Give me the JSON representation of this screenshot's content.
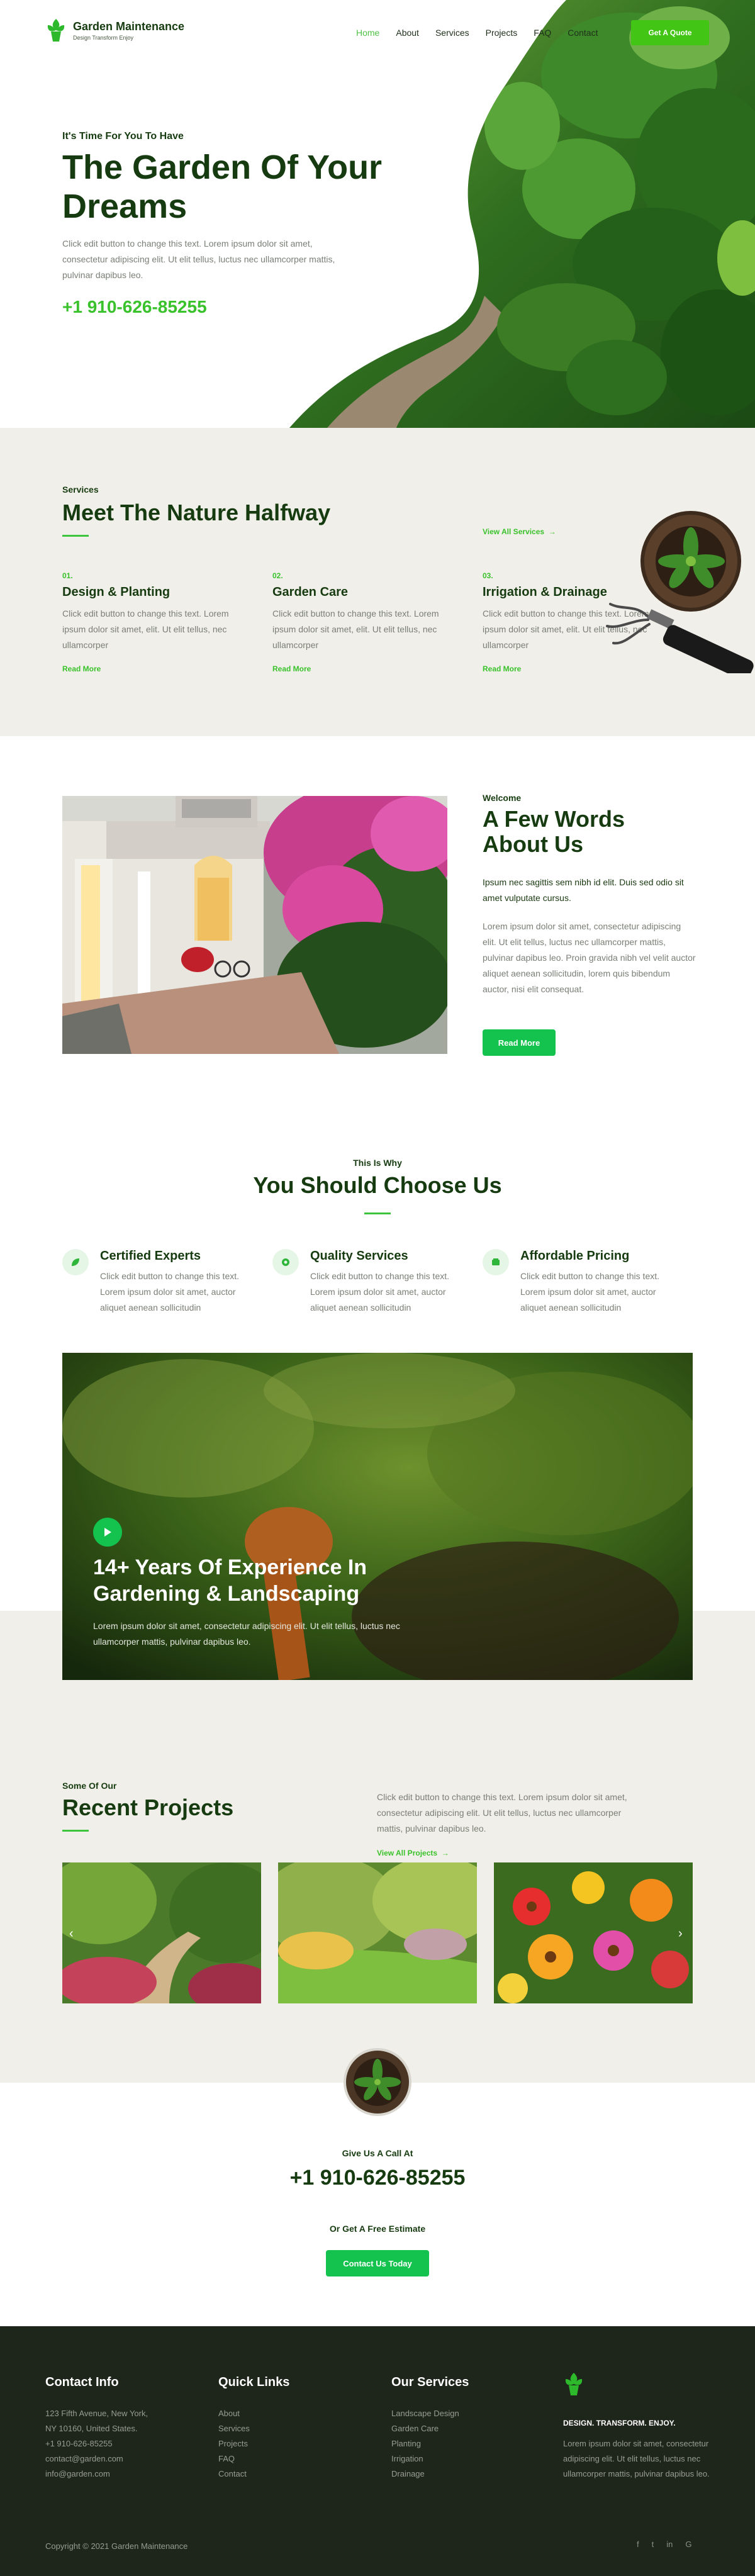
{
  "brand": {
    "name": "Garden Maintenance",
    "tagline": "Design Transform Enjoy"
  },
  "nav": {
    "items": [
      "Home",
      "About",
      "Services",
      "Projects",
      "FAQ",
      "Contact"
    ],
    "active": "Home",
    "cta_label": "Get A Quote"
  },
  "hero": {
    "eyebrow": "It's Time For You To Have",
    "title": "The Garden Of Your Dreams",
    "text": "Click edit button to change this text. Lorem ipsum dolor sit amet, consectetur adipiscing elit. Ut elit tellus, luctus nec ullamcorper mattis, pulvinar dapibus leo.",
    "phone": "+1 910-626-85255"
  },
  "services": {
    "eyebrow": "Services",
    "title": "Meet The Nature Halfway",
    "view_all": "View All Services",
    "items": [
      {
        "num": "01.",
        "title": "Design & Planting",
        "text": "Click edit button to change this text. Lorem ipsum dolor sit amet, elit. Ut elit tellus, nec ullamcorper",
        "more": "Read More"
      },
      {
        "num": "02.",
        "title": "Garden Care",
        "text": "Click edit button to change this text. Lorem ipsum dolor sit amet, elit. Ut elit tellus, nec ullamcorper",
        "more": "Read More"
      },
      {
        "num": "03.",
        "title": "Irrigation & Drainage",
        "text": "Click edit button to change this text. Lorem ipsum dolor sit amet, elit. Ut elit tellus, nec ullamcorper",
        "more": "Read More"
      }
    ]
  },
  "about": {
    "eyebrow": "Welcome",
    "title": "A Few Words About Us",
    "lead": "Ipsum nec sagittis sem nibh id elit. Duis sed odio sit amet vulputate cursus.",
    "text": "Lorem ipsum dolor sit amet, consectetur adipiscing elit. Ut elit tellus, luctus nec ullamcorper mattis, pulvinar dapibus leo. Proin gravida nibh vel velit auctor aliquet aenean sollicitudin, lorem quis bibendum auctor, nisi elit consequat.",
    "button": "Read More"
  },
  "why": {
    "eyebrow": "This Is Why",
    "title": "You Should Choose Us",
    "items": [
      {
        "title": "Certified Experts",
        "text": "Click edit button to change this text. Lorem ipsum dolor sit amet, auctor aliquet aenean sollicitudin",
        "icon": "leaf-icon"
      },
      {
        "title": "Quality Services",
        "text": "Click edit button to change this text. Lorem ipsum dolor sit amet, auctor aliquet aenean sollicitudin",
        "icon": "badge-icon"
      },
      {
        "title": "Affordable Pricing",
        "text": "Click edit button to change this text. Lorem ipsum dolor sit amet, auctor aliquet aenean sollicitudin",
        "icon": "wallet-icon"
      }
    ]
  },
  "video": {
    "title": "14+ Years Of Experience In Gardening & Landscaping",
    "text": "Lorem ipsum dolor sit amet, consectetur adipiscing elit. Ut elit tellus, luctus nec ullamcorper mattis, pulvinar dapibus leo."
  },
  "projects": {
    "eyebrow": "Some Of Our",
    "title": "Recent Projects",
    "text": "Click edit button to change this text. Lorem ipsum dolor sit amet, consectetur adipiscing elit. Ut elit tellus, luctus nec ullamcorper mattis, pulvinar dapibus leo.",
    "view_all": "View All Projects"
  },
  "call": {
    "eyebrow": "Give Us A Call At",
    "phone": "+1 910-626-85255",
    "sub": "Or Get A Free Estimate",
    "button": "Contact Us Today"
  },
  "footer": {
    "contact": {
      "title": "Contact Info",
      "lines": [
        "123 Fifth Avenue, New York,",
        "NY 10160, United States.",
        "+1 910-626-85255",
        "contact@garden.com",
        "info@garden.com"
      ]
    },
    "quick": {
      "title": "Quick Links",
      "links": [
        "About",
        "Services",
        "Projects",
        "FAQ",
        "Contact"
      ]
    },
    "services": {
      "title": "Our Services",
      "links": [
        "Landscape Design",
        "Garden Care",
        "Planting",
        "Irrigation",
        "Drainage"
      ]
    },
    "brand": {
      "tagline": "DESIGN. TRANSFORM. ENJOY.",
      "text": "Lorem ipsum dolor sit amet, consectetur adipiscing elit. Ut elit tellus, luctus nec ullamcorper mattis, pulvinar dapibus leo."
    },
    "copyright": "Copyright © 2021 Garden Maintenance",
    "social": [
      "facebook-icon",
      "twitter-icon",
      "linkedin-icon",
      "google-icon"
    ]
  },
  "colors": {
    "brand_green": "#43c515",
    "dark_green": "#173b10",
    "accent_green": "#39c22b",
    "cream": "#f1efe9",
    "footer_bg": "#1e261b"
  }
}
